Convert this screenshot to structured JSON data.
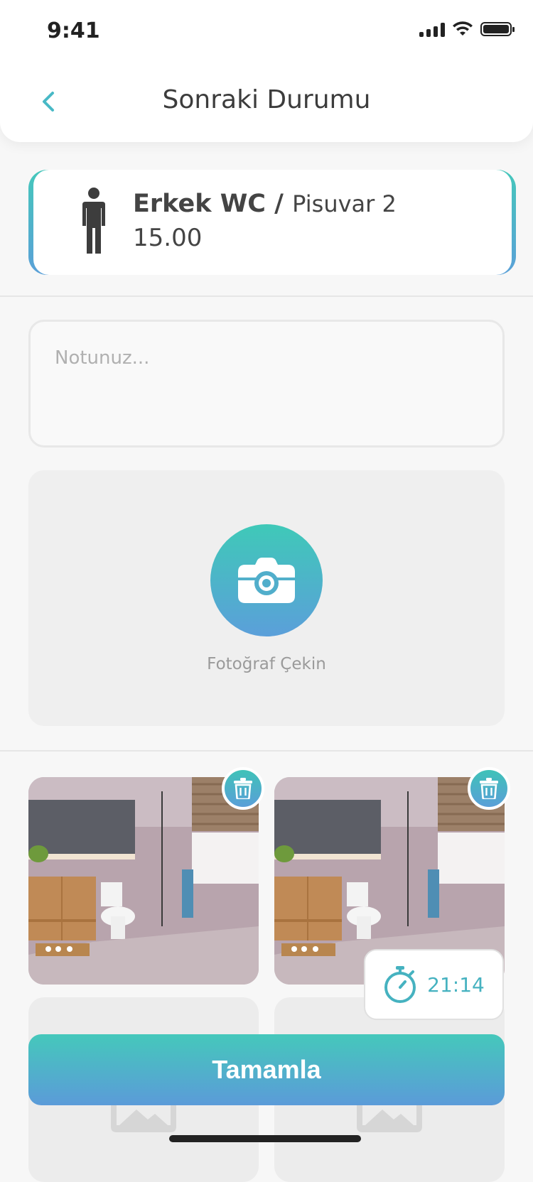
{
  "status_bar": {
    "time": "9:41"
  },
  "header": {
    "title": "Sonraki Durumu"
  },
  "location": {
    "area": "Erkek WC",
    "separator": " / ",
    "unit": "Pisuvar 2",
    "time": "15.00"
  },
  "note": {
    "placeholder": "Notunuz..."
  },
  "capture": {
    "label": "Fotoğraf Çekin"
  },
  "timer": {
    "value": "21:14"
  },
  "actions": {
    "complete_label": "Tamamla"
  },
  "colors": {
    "accent_start": "#45c8bb",
    "accent_end": "#5b9bd9"
  }
}
